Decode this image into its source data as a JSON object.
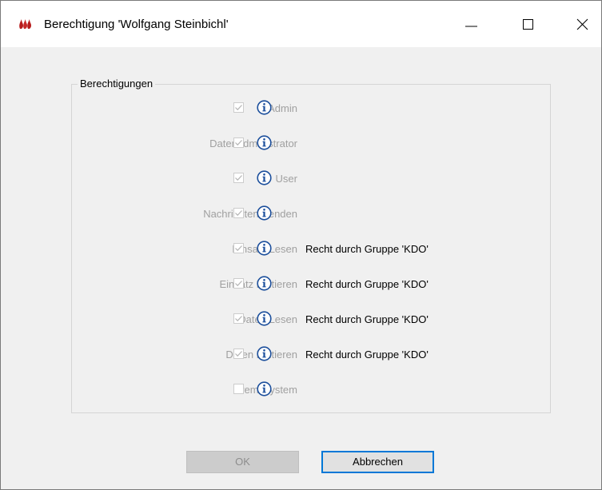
{
  "window": {
    "title": "Berechtigung 'Wolfgang Steinbichl'"
  },
  "group": {
    "label": "Berechtigungen"
  },
  "permissions": [
    {
      "label": "Admin",
      "checked": true,
      "note": ""
    },
    {
      "label": "Datenadministrator",
      "checked": true,
      "note": ""
    },
    {
      "label": "User",
      "checked": true,
      "note": ""
    },
    {
      "label": "Nachrichten Senden",
      "checked": true,
      "note": ""
    },
    {
      "label": "Einsatz Lesen",
      "checked": true,
      "note": "Recht durch Gruppe 'KDO'"
    },
    {
      "label": "Einsatz Editieren",
      "checked": true,
      "note": "Recht durch Gruppe 'KDO'"
    },
    {
      "label": "Daten Lesen",
      "checked": true,
      "note": "Recht durch Gruppe 'KDO'"
    },
    {
      "label": "Daten Editieren",
      "checked": true,
      "note": "Recht durch Gruppe 'KDO'"
    },
    {
      "label": "Fremdsystem",
      "checked": false,
      "note": ""
    }
  ],
  "buttons": {
    "ok": "OK",
    "cancel": "Abbrechen"
  },
  "colors": {
    "info_icon": "#1c4f9c",
    "focus_border": "#0078d7",
    "disabled_text": "#a0a0a0"
  }
}
